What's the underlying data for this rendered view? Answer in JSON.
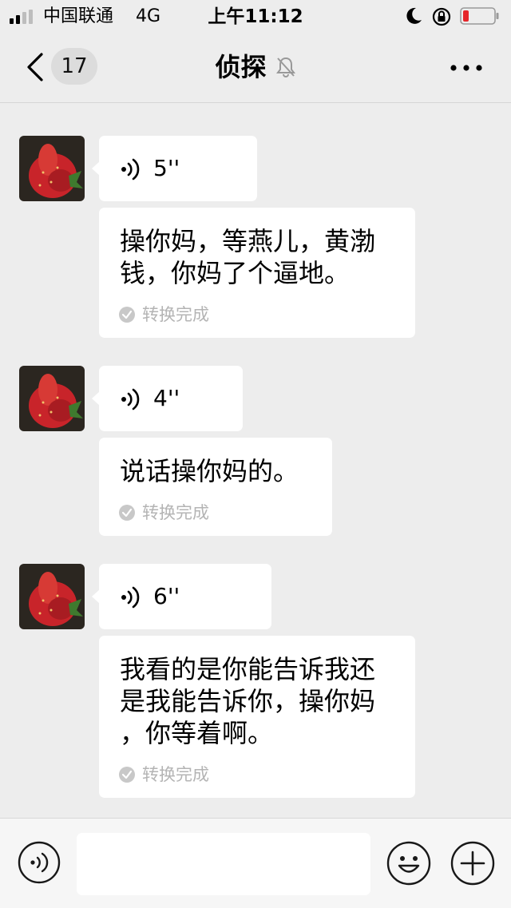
{
  "status_bar": {
    "carrier": "中国联通",
    "network": "4G",
    "time": "上午11:12",
    "icons": [
      "signal-icon",
      "moon-icon",
      "rotation-lock-icon",
      "battery-icon"
    ],
    "battery_color": "#e5262a"
  },
  "nav": {
    "back_icon": "chevron-left-icon",
    "unread_count": "17",
    "title": "侦探",
    "mute_icon": "bell-muted-icon",
    "more_icon": "more-dots-icon"
  },
  "messages": [
    {
      "voice_duration": "5''",
      "transcript": "操你妈，等燕儿，黄渤\n钱，你妈了个逼地。",
      "status": "转换完成"
    },
    {
      "voice_duration": "4''",
      "transcript": "说话操你妈的。",
      "status": "转换完成"
    },
    {
      "voice_duration": "6''",
      "transcript": "我看的是你能告诉我还\n是我能告诉你，操你妈\n，你等着啊。",
      "status": "转换完成"
    }
  ],
  "input_bar": {
    "voice_icon": "voice-input-icon",
    "placeholder": "",
    "emoji_icon": "emoji-icon",
    "plus_icon": "plus-icon"
  },
  "colors": {
    "background": "#ededed",
    "bubble": "#ffffff",
    "status_text": "#b4b4b4"
  }
}
